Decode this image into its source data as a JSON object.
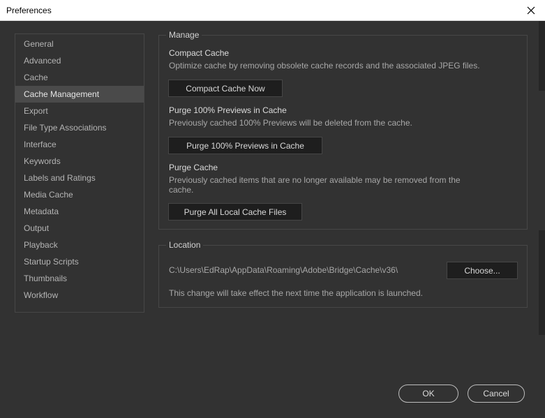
{
  "window": {
    "title": "Preferences"
  },
  "sidebar": {
    "items": [
      {
        "label": "General"
      },
      {
        "label": "Advanced"
      },
      {
        "label": "Cache"
      },
      {
        "label": "Cache Management"
      },
      {
        "label": "Export"
      },
      {
        "label": "File Type Associations"
      },
      {
        "label": "Interface"
      },
      {
        "label": "Keywords"
      },
      {
        "label": "Labels and Ratings"
      },
      {
        "label": "Media Cache"
      },
      {
        "label": "Metadata"
      },
      {
        "label": "Output"
      },
      {
        "label": "Playback"
      },
      {
        "label": "Startup Scripts"
      },
      {
        "label": "Thumbnails"
      },
      {
        "label": "Workflow"
      }
    ],
    "selected": "Cache Management"
  },
  "manage": {
    "title": "Manage",
    "compact": {
      "heading": "Compact Cache",
      "description": "Optimize cache by removing obsolete cache records and the associated JPEG files.",
      "button": "Compact Cache Now"
    },
    "purge_previews": {
      "heading": "Purge 100% Previews in Cache",
      "description": "Previously cached 100% Previews will be deleted from the cache.",
      "button": "Purge 100% Previews in Cache"
    },
    "purge_cache": {
      "heading": "Purge Cache",
      "description_line1": "Previously cached items that are no longer available may be removed from the",
      "description_line2": "cache.",
      "button": "Purge All Local Cache Files"
    }
  },
  "location": {
    "title": "Location",
    "path": "C:\\Users\\EdRap\\AppData\\Roaming\\Adobe\\Bridge\\Cache\\v36\\",
    "choose_button": "Choose...",
    "note": "This change will take effect the next time the application is launched."
  },
  "footer": {
    "ok": "OK",
    "cancel": "Cancel"
  },
  "colors": {
    "background": "#323232",
    "selected": "#4a4a4a",
    "button": "#1e1e1e",
    "titlebar": "#ffffff"
  }
}
